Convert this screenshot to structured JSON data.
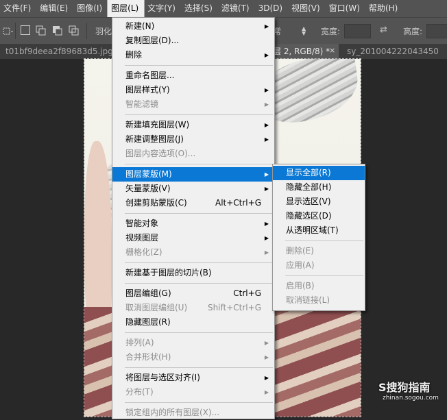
{
  "menubar": {
    "items": [
      {
        "label": "文件(F)",
        "active": false
      },
      {
        "label": "编辑(E)",
        "active": false
      },
      {
        "label": "图像(I)",
        "active": false
      },
      {
        "label": "图层(L)",
        "active": true
      },
      {
        "label": "文字(Y)",
        "active": false
      },
      {
        "label": "选择(S)",
        "active": false
      },
      {
        "label": "滤镜(T)",
        "active": false
      },
      {
        "label": "3D(D)",
        "active": false
      },
      {
        "label": "视图(V)",
        "active": false
      },
      {
        "label": "窗口(W)",
        "active": false
      },
      {
        "label": "帮助(H)",
        "active": false
      }
    ]
  },
  "optionsbar": {
    "feather_label": "羽化",
    "style_value": "常",
    "width_label": "宽度:",
    "height_label": "高度:",
    "swap_icon": "swap-arrows-icon"
  },
  "tabs": [
    {
      "label": "t01bf9deea2f89683d5.jpg",
      "active": false
    },
    {
      "label": "层 2, RGB/8) *",
      "active": true
    },
    {
      "label": "sy_201004222043450",
      "active": false
    }
  ],
  "tab_close_glyph": "×",
  "layer_menu": {
    "groups": [
      [
        {
          "label": "新建(N)",
          "shortcut": "",
          "submenu": true,
          "disabled": false,
          "highlight": false
        },
        {
          "label": "复制图层(D)...",
          "shortcut": "",
          "submenu": false,
          "disabled": false,
          "highlight": false
        },
        {
          "label": "删除",
          "shortcut": "",
          "submenu": true,
          "disabled": false,
          "highlight": false
        }
      ],
      [
        {
          "label": "重命名图层...",
          "shortcut": "",
          "submenu": false,
          "disabled": false,
          "highlight": false
        },
        {
          "label": "图层样式(Y)",
          "shortcut": "",
          "submenu": true,
          "disabled": false,
          "highlight": false
        },
        {
          "label": "智能滤镜",
          "shortcut": "",
          "submenu": true,
          "disabled": true,
          "highlight": false
        }
      ],
      [
        {
          "label": "新建填充图层(W)",
          "shortcut": "",
          "submenu": true,
          "disabled": false,
          "highlight": false
        },
        {
          "label": "新建调整图层(J)",
          "shortcut": "",
          "submenu": true,
          "disabled": false,
          "highlight": false
        },
        {
          "label": "图层内容选项(O)...",
          "shortcut": "",
          "submenu": false,
          "disabled": true,
          "highlight": false
        }
      ],
      [
        {
          "label": "图层蒙版(M)",
          "shortcut": "",
          "submenu": true,
          "disabled": false,
          "highlight": true
        },
        {
          "label": "矢量蒙版(V)",
          "shortcut": "",
          "submenu": true,
          "disabled": false,
          "highlight": false
        },
        {
          "label": "创建剪贴蒙版(C)",
          "shortcut": "Alt+Ctrl+G",
          "submenu": false,
          "disabled": false,
          "highlight": false
        }
      ],
      [
        {
          "label": "智能对象",
          "shortcut": "",
          "submenu": true,
          "disabled": false,
          "highlight": false
        },
        {
          "label": "视频图层",
          "shortcut": "",
          "submenu": true,
          "disabled": false,
          "highlight": false
        },
        {
          "label": "栅格化(Z)",
          "shortcut": "",
          "submenu": true,
          "disabled": true,
          "highlight": false
        }
      ],
      [
        {
          "label": "新建基于图层的切片(B)",
          "shortcut": "",
          "submenu": false,
          "disabled": false,
          "highlight": false
        }
      ],
      [
        {
          "label": "图层编组(G)",
          "shortcut": "Ctrl+G",
          "submenu": false,
          "disabled": false,
          "highlight": false
        },
        {
          "label": "取消图层编组(U)",
          "shortcut": "Shift+Ctrl+G",
          "submenu": false,
          "disabled": true,
          "highlight": false
        },
        {
          "label": "隐藏图层(R)",
          "shortcut": "",
          "submenu": false,
          "disabled": false,
          "highlight": false
        }
      ],
      [
        {
          "label": "排列(A)",
          "shortcut": "",
          "submenu": true,
          "disabled": true,
          "highlight": false
        },
        {
          "label": "合并形状(H)",
          "shortcut": "",
          "submenu": true,
          "disabled": true,
          "highlight": false
        }
      ],
      [
        {
          "label": "将图层与选区对齐(I)",
          "shortcut": "",
          "submenu": true,
          "disabled": false,
          "highlight": false
        },
        {
          "label": "分布(T)",
          "shortcut": "",
          "submenu": true,
          "disabled": true,
          "highlight": false
        }
      ],
      [
        {
          "label": "锁定组内的所有图层(X)...",
          "shortcut": "",
          "submenu": false,
          "disabled": true,
          "highlight": false
        }
      ]
    ]
  },
  "mask_submenu": {
    "groups": [
      [
        {
          "label": "显示全部(R)",
          "disabled": false,
          "highlight": true
        },
        {
          "label": "隐藏全部(H)",
          "disabled": false,
          "highlight": false
        },
        {
          "label": "显示选区(V)",
          "disabled": false,
          "highlight": false
        },
        {
          "label": "隐藏选区(D)",
          "disabled": false,
          "highlight": false
        },
        {
          "label": "从透明区域(T)",
          "disabled": false,
          "highlight": false
        }
      ],
      [
        {
          "label": "删除(E)",
          "disabled": true,
          "highlight": false
        },
        {
          "label": "应用(A)",
          "disabled": true,
          "highlight": false
        }
      ],
      [
        {
          "label": "启用(B)",
          "disabled": true,
          "highlight": false
        },
        {
          "label": "取消链接(L)",
          "disabled": true,
          "highlight": false
        }
      ]
    ]
  },
  "watermark": {
    "logo": "S搜狗指南",
    "url": "zhinan.sogou.com"
  },
  "colors": {
    "highlight": "#0a78d4",
    "menu_bg": "#f0f0f0",
    "menubar_bg": "#535353"
  }
}
